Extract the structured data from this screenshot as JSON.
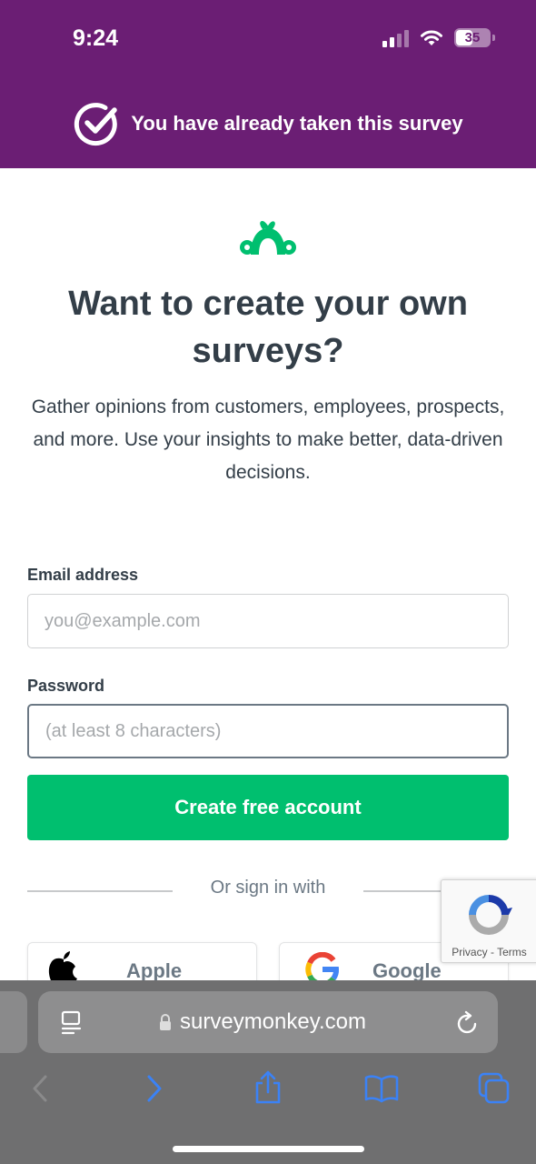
{
  "status_bar": {
    "time": "9:24",
    "battery_level": "35"
  },
  "banner": {
    "text": "You have already taken this survey"
  },
  "main": {
    "headline": "Want to create your own surveys?",
    "subtext": "Gather opinions from customers, employees, prospects, and more. Use your insights to make better, data-driven decisions."
  },
  "form": {
    "email_label": "Email address",
    "email_placeholder": "you@example.com",
    "email_value": "",
    "password_label": "Password",
    "password_placeholder": "(at least 8 characters)",
    "password_value": "",
    "submit_label": "Create free account"
  },
  "sso": {
    "divider_text": "Or sign in with",
    "apple_label": "Apple",
    "google_label": "Google"
  },
  "recaptcha": {
    "privacy_label": "Privacy",
    "separator": " - ",
    "terms_label": "Terms"
  },
  "browser": {
    "url": "surveymonkey.com"
  },
  "colors": {
    "brand_purple": "#6b1e74",
    "brand_green": "#00bf6f",
    "text_dark": "#333e48",
    "safari_blue": "#3b82f6"
  }
}
